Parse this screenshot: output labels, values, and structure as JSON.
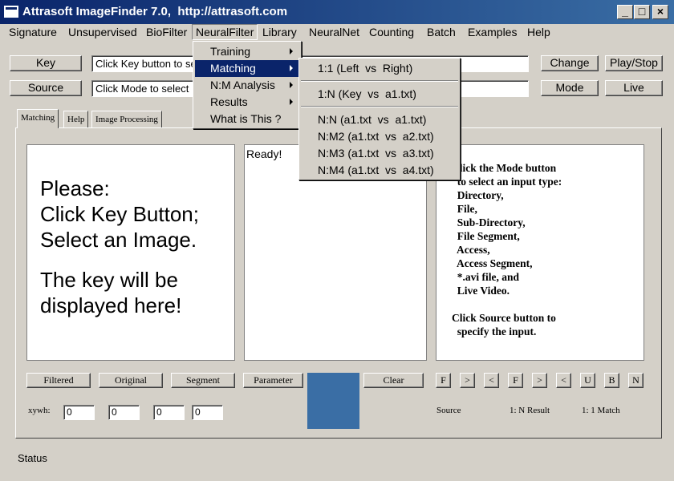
{
  "window": {
    "title": "Attrasoft ImageFinder 7.0,  http://attrasoft.com",
    "icon": "app-window-icon",
    "minimize_glyph": "_",
    "maximize_glyph": "□",
    "close_glyph": "×"
  },
  "menubar": [
    "Signature",
    "Unsupervised",
    "BioFilter",
    "NeuralFilter",
    "Library",
    "NeuralNet",
    "Counting",
    "Batch",
    "Examples",
    "Help"
  ],
  "active_menu": "NeuralFilter",
  "neuralfilter_menu": {
    "items": [
      "Training",
      "Matching",
      "N:M Analysis",
      "Results",
      "What is This ?"
    ],
    "highlighted": "Matching"
  },
  "matching_submenu": {
    "items": [
      "1:1 (Left  vs  Right)",
      "1:N (Key  vs  a1.txt)",
      "N:N (a1.txt  vs  a1.txt)",
      "N:M2 (a1.txt  vs  a2.txt)",
      "N:M3 (a1.txt  vs  a3.txt)",
      "N:M4 (a1.txt  vs  a4.txt)"
    ]
  },
  "toolbar": {
    "key_label": "Key",
    "key_field": "Click Key button to se",
    "source_label": "Source",
    "source_field": "Click Mode to select",
    "change_label": "Change",
    "playstop_label": "Play/Stop",
    "mode_label": "Mode",
    "live_label": "Live"
  },
  "tabs": [
    "Matching",
    "Help",
    "Image Processing"
  ],
  "selected_tab": "Matching",
  "key_panel": {
    "lines": [
      "Please:",
      "Click Key Button;",
      "Select an Image."
    ],
    "lines2": [
      "The key will be",
      "displayed here!"
    ]
  },
  "results_panel": {
    "text": "Ready!"
  },
  "instructions": [
    "Click the Mode button",
    "  to select an input type:",
    "  Directory,",
    "  File,",
    "  Sub-Directory,",
    "  File Segment,",
    "  Access,",
    "  Access Segment,",
    "  *.avi file, and",
    "  Live Video.",
    "",
    "Click Source button to",
    "  specify the input."
  ],
  "bottom_buttons": {
    "filtered": "Filtered",
    "original": "Original",
    "segment": "Segment",
    "parameter": "Parameter",
    "clear": "Clear"
  },
  "nav_buttons": [
    "F",
    ">",
    "<",
    "F",
    ">",
    "<",
    "U",
    "B",
    "N"
  ],
  "xywh": {
    "label": "xywh:",
    "values": [
      "0",
      "0",
      "0",
      "0"
    ]
  },
  "color_preview": "#3a6ea5",
  "bottom_labels": {
    "source": "Source",
    "result": "1: N Result",
    "match": "1: 1 Match"
  },
  "status": "Status",
  "colors": {
    "titlebar": "#0a246a",
    "menu_highlight": "#0a246a",
    "face": "#d4d0c8"
  }
}
